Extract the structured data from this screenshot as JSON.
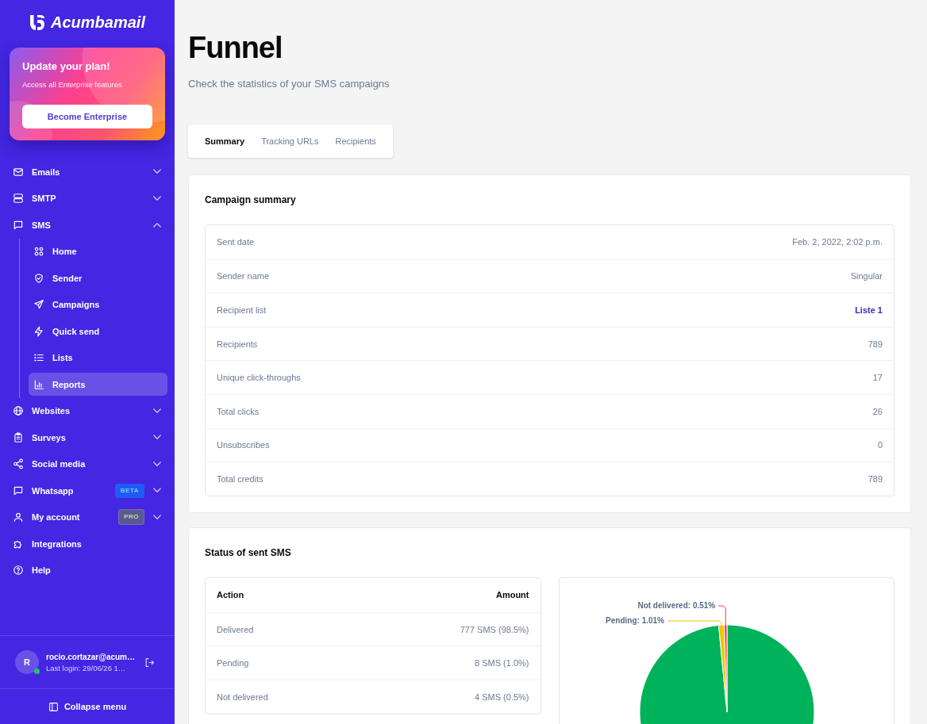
{
  "sidebar": {
    "logo": "Acumbamail",
    "promo": {
      "title": "Update your plan!",
      "text": "Access all Enterprise features",
      "button": "Become Enterprise"
    },
    "items": [
      {
        "label": "Emails",
        "kind": "menu",
        "expanded": false,
        "selected": false
      },
      {
        "label": "SMTP",
        "kind": "menu",
        "expanded": false,
        "selected": false
      },
      {
        "label": "SMS",
        "kind": "menu",
        "expanded": true,
        "selected": false,
        "children": [
          {
            "label": "Home",
            "selected": false
          },
          {
            "label": "Sender",
            "selected": false
          },
          {
            "label": "Campaigns",
            "selected": false
          },
          {
            "label": "Quick send",
            "selected": false
          },
          {
            "label": "Lists",
            "selected": false
          },
          {
            "label": "Reports",
            "selected": true
          }
        ]
      },
      {
        "label": "Websites",
        "kind": "menu",
        "expanded": false,
        "selected": false
      },
      {
        "label": "Surveys",
        "kind": "menu",
        "expanded": false,
        "selected": false
      },
      {
        "label": "Social media",
        "kind": "menu",
        "expanded": false,
        "selected": false
      },
      {
        "label": "Whatsapp",
        "kind": "menu",
        "expanded": false,
        "selected": false,
        "badge": {
          "text": "BETA",
          "kind": "beta"
        }
      },
      {
        "label": "My account",
        "kind": "menu",
        "expanded": false,
        "selected": false,
        "badge": {
          "text": "PRO",
          "kind": "pro"
        }
      },
      {
        "label": "Integrations",
        "kind": "link",
        "selected": false
      },
      {
        "label": "Help",
        "kind": "link",
        "selected": false
      }
    ],
    "user": {
      "initial": "R",
      "online": true,
      "email": "rocio.cortazar@acum…",
      "last_login": "Last login: 29/06/26 1…"
    },
    "collapse": "Collapse menu"
  },
  "page": {
    "title": "Funnel",
    "subtitle": "Check the statistics of your SMS campaigns"
  },
  "tabs": [
    {
      "label": "Summary",
      "selected": true
    },
    {
      "label": "Tracking URLs",
      "selected": false
    },
    {
      "label": "Recipients",
      "selected": false
    }
  ],
  "campaign_summary": {
    "title": "Campaign summary",
    "rows": [
      {
        "label": "Sent date",
        "value": "Feb. 2, 2022, 2:02 p.m.",
        "kind": "text"
      },
      {
        "label": "Sender name",
        "value": "Singular",
        "kind": "text"
      },
      {
        "label": "Recipient list",
        "value": "Liste 1",
        "kind": "link"
      },
      {
        "label": "Recipients",
        "value": "789",
        "kind": "text"
      },
      {
        "label": "Unique click-throughs",
        "value": "17",
        "kind": "text"
      },
      {
        "label": "Total clicks",
        "value": "26",
        "kind": "text"
      },
      {
        "label": "Unsubscribes",
        "value": "0",
        "kind": "text"
      },
      {
        "label": "Total credits",
        "value": "789",
        "kind": "text"
      }
    ]
  },
  "sms_status": {
    "title": "Status of sent SMS",
    "table": {
      "columns": [
        "Action",
        "Amount"
      ],
      "rows": [
        [
          "Delivered",
          "777 SMS (98.5%)"
        ],
        [
          "Pending",
          "8 SMS (1.0%)"
        ],
        [
          "Not delivered",
          "4 SMS (0.5%)"
        ]
      ]
    },
    "chart_data": {
      "type": "pie",
      "values": [
        98.48,
        1.01,
        0.51
      ],
      "colors": [
        "#00b259",
        "#f5c400",
        "#e5414b"
      ],
      "value_labels": [
        null,
        "Pending: 1.01%",
        "Not delivered: 0.51%"
      ]
    }
  }
}
